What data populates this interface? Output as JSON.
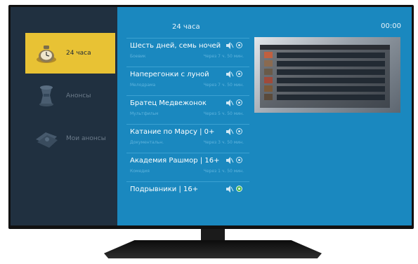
{
  "header": {
    "title": "24 часа",
    "time": "00:00"
  },
  "sidebar": {
    "items": [
      {
        "label": "24 часа",
        "icon": "clock-icon",
        "active": true
      },
      {
        "label": "Анонсы",
        "icon": "hourglass-icon",
        "active": false
      },
      {
        "label": "Мои анонсы",
        "icon": "tickets-icon",
        "active": false
      }
    ]
  },
  "list": [
    {
      "title": "Шесть дней, семь ночей",
      "genre": "Боевик",
      "when": "Через 7 ч. 50 мин."
    },
    {
      "title": "Наперегонки с луной",
      "genre": "Мелодрама",
      "when": "Через 7 ч. 50 мин."
    },
    {
      "title": "Братец Медвежонок",
      "genre": "Мультфильм",
      "when": "Через 5 ч. 50 мин."
    },
    {
      "title": "Катание по Марсу | 0+",
      "genre": "Документальн.",
      "when": "Через 3 ч. 50 мин."
    },
    {
      "title": "Академия Рашмор | 16+",
      "genre": "Комедия",
      "when": "Через 1 ч. 50 мин."
    },
    {
      "title": "Подрывники | 16+",
      "genre": "",
      "when": ""
    }
  ],
  "colors": {
    "sidebar_bg": "#203040",
    "main_bg": "#1a88bf",
    "active_bg": "#e8c234",
    "selected_radio": "#4cb84a"
  }
}
